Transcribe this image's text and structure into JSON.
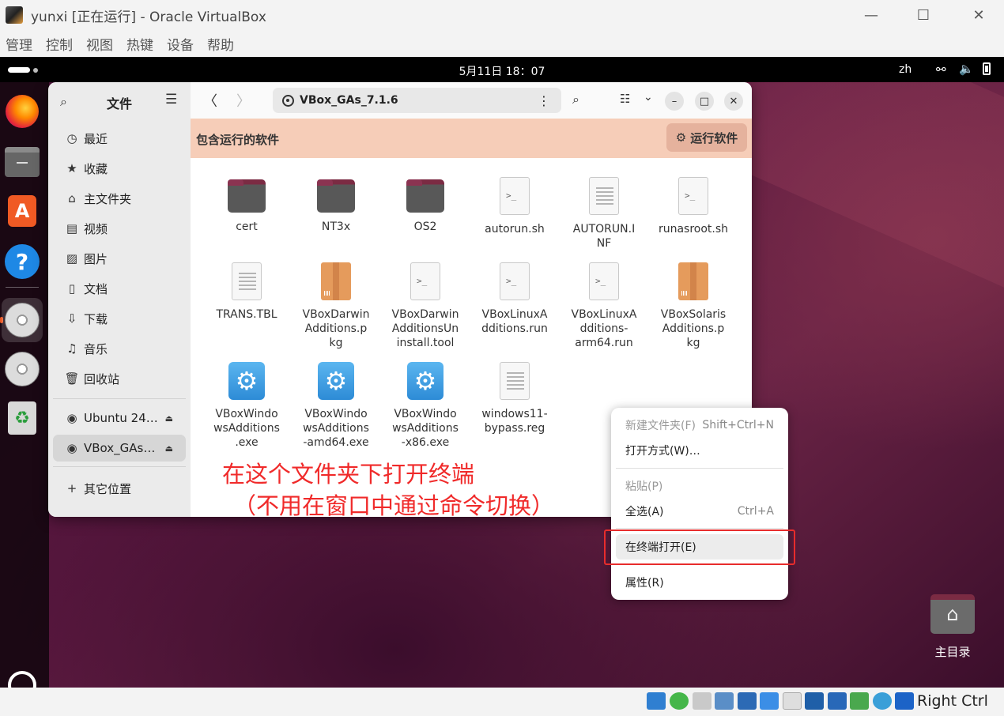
{
  "vbox": {
    "title": "yunxi [正在运行] - Oracle VirtualBox",
    "menu": [
      "管理",
      "控制",
      "视图",
      "热键",
      "设备",
      "帮助"
    ],
    "host_key": "Right Ctrl"
  },
  "topbar": {
    "clock": "5月11日  18：07",
    "lang": "zh"
  },
  "files": {
    "sidebar_title": "文件",
    "places": [
      {
        "icon": "clock-icon",
        "label": "最近"
      },
      {
        "icon": "star-icon",
        "label": "收藏"
      },
      {
        "icon": "home-icon",
        "label": "主文件夹"
      },
      {
        "icon": "video-icon",
        "label": "视频"
      },
      {
        "icon": "picture-icon",
        "label": "图片"
      },
      {
        "icon": "document-icon",
        "label": "文档"
      },
      {
        "icon": "download-icon",
        "label": "下载"
      },
      {
        "icon": "music-icon",
        "label": "音乐"
      },
      {
        "icon": "trash-icon",
        "label": "回收站"
      }
    ],
    "devices": [
      {
        "label": "Ubuntu 24…"
      },
      {
        "label": "VBox_GAs…"
      }
    ],
    "other_locations": "其它位置",
    "path": "VBox_GAs_7.1.6",
    "banner_text": "包含运行的软件",
    "run_button": "运行软件",
    "items": [
      {
        "name": "cert",
        "kind": "folder"
      },
      {
        "name": "NT3x",
        "kind": "folder"
      },
      {
        "name": "OS2",
        "kind": "folder"
      },
      {
        "name": "autorun.sh",
        "kind": "script"
      },
      {
        "name": "AUTORUN.INF",
        "kind": "text",
        "lines": [
          "AUTORUN.I",
          "NF"
        ]
      },
      {
        "name": "runasroot.sh",
        "kind": "script"
      },
      {
        "name": "TRANS.TBL",
        "kind": "text"
      },
      {
        "name": "VBoxDarwinAdditions.pkg",
        "kind": "package",
        "lines": [
          "VBoxDarwin",
          "Additions.p",
          "kg"
        ]
      },
      {
        "name": "VBoxDarwinAdditionsUninstall.tool",
        "kind": "script",
        "lines": [
          "VBoxDarwin",
          "AdditionsUn",
          "install.tool"
        ]
      },
      {
        "name": "VBoxLinuxAdditions.run",
        "kind": "script",
        "lines": [
          "VBoxLinuxA",
          "dditions.run"
        ]
      },
      {
        "name": "VBoxLinuxAdditions-arm64.run",
        "kind": "script",
        "lines": [
          "VBoxLinuxA",
          "dditions-",
          "arm64.run"
        ]
      },
      {
        "name": "VBoxSolarisAdditions.pkg",
        "kind": "package",
        "lines": [
          "VBoxSolaris",
          "Additions.p",
          "kg"
        ]
      },
      {
        "name": "VBoxWindowsAdditions.exe",
        "kind": "exe",
        "lines": [
          "VBoxWindo",
          "wsAdditions",
          ".exe"
        ]
      },
      {
        "name": "VBoxWindowsAdditions-amd64.exe",
        "kind": "exe",
        "lines": [
          "VBoxWindo",
          "wsAdditions",
          "-amd64.exe"
        ]
      },
      {
        "name": "VBoxWindowsAdditions-x86.exe",
        "kind": "exe",
        "lines": [
          "VBoxWindo",
          "wsAdditions",
          "-x86.exe"
        ]
      },
      {
        "name": "windows11-bypass.reg",
        "kind": "text",
        "lines": [
          "windows11-",
          "bypass.reg"
        ]
      }
    ]
  },
  "annotation": {
    "line1": "在这个文件夹下打开终端",
    "line2": "（不用在窗口中通过命令切换）",
    "color": "#f02a2a"
  },
  "context_menu": {
    "items": [
      {
        "label": "新建文件夹(F)",
        "shortcut": "Shift+Ctrl+N",
        "disabled": true
      },
      {
        "label": "打开方式(W)…",
        "shortcut": "",
        "disabled": false
      },
      {
        "label": "粘贴(P)",
        "shortcut": "",
        "disabled": true
      },
      {
        "label": "全选(A)",
        "shortcut": "Ctrl+A",
        "disabled": false
      },
      {
        "label": "在终端打开(E)",
        "shortcut": "",
        "disabled": false,
        "highlighted": true
      },
      {
        "label": "属性(R)",
        "shortcut": "",
        "disabled": false
      }
    ]
  },
  "desktop": {
    "home_label": "主目录"
  }
}
